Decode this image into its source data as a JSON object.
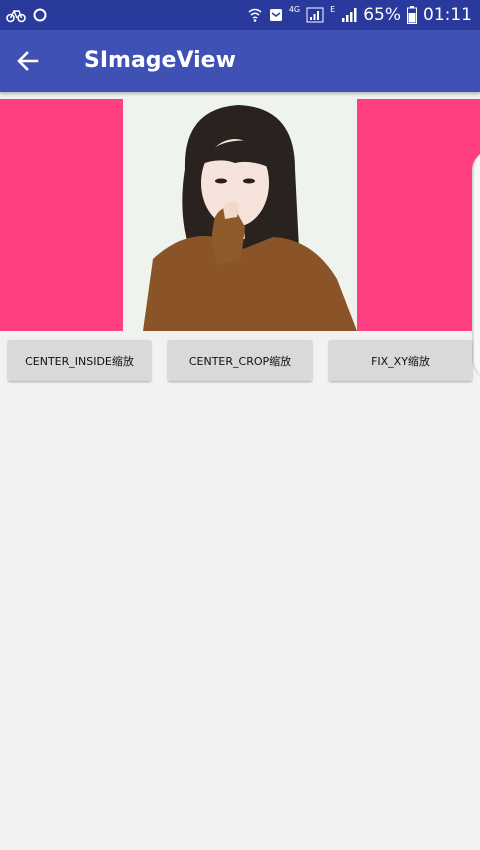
{
  "status_bar": {
    "network_type": "4G",
    "signal_label": "E",
    "battery": "65%",
    "time": "01:11"
  },
  "app_bar": {
    "title": "SImageView",
    "back_icon": "arrow-back-icon"
  },
  "image_view": {
    "background_color": "#ff3f7f"
  },
  "buttons": [
    {
      "label": "CENTER_INSIDE缩放"
    },
    {
      "label": "CENTER_CROP缩放"
    },
    {
      "label": "FIX_XY缩放"
    }
  ],
  "colors": {
    "status_bar": "#2a3a9c",
    "app_bar": "#3f51b5",
    "button": "#d9d9d9",
    "page": "#f2f2f2"
  }
}
